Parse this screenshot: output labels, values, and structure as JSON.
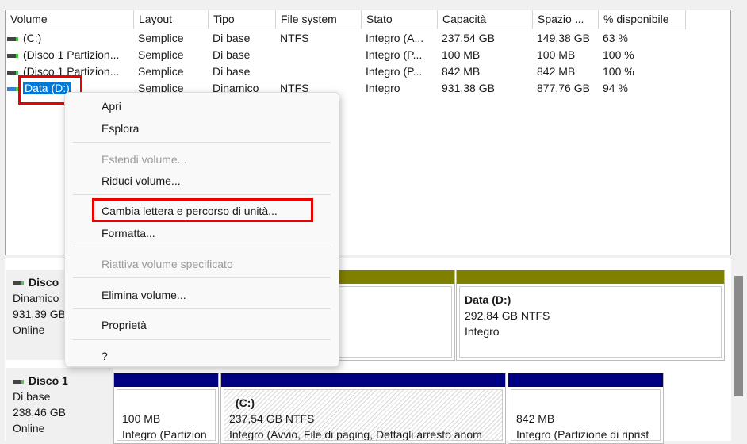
{
  "columns": [
    "Volume",
    "Layout",
    "Tipo",
    "File system",
    "Stato",
    "Capacità",
    "Spazio ...",
    "% disponibile"
  ],
  "rows": [
    [
      "(C:)",
      "Semplice",
      "Di base",
      "NTFS",
      "Integro (A...",
      "237,54 GB",
      "149,38 GB",
      "63 %"
    ],
    [
      "(Disco 1 Partizion...",
      "Semplice",
      "Di base",
      "",
      "Integro (P...",
      "100 MB",
      "100 MB",
      "100 %"
    ],
    [
      "(Disco 1 Partizion...",
      "Semplice",
      "Di base",
      "",
      "Integro (P...",
      "842 MB",
      "842 MB",
      "100 %"
    ],
    [
      "Data (D:)",
      "Semplice",
      "Dinamico",
      "NTFS",
      "Integro",
      "931,38 GB",
      "877,76 GB",
      "94 %"
    ]
  ],
  "menu": {
    "open": "Apri",
    "explore": "Esplora",
    "extend": "Estendi volume...",
    "shrink": "Riduci volume...",
    "change_letter": "Cambia lettera e percorso di unità...",
    "format": "Formatta...",
    "reactivate": "Riattiva volume specificato",
    "delete": "Elimina volume...",
    "properties": "Proprietà",
    "help": "?"
  },
  "disk0": {
    "name": "Disco",
    "type": "Dinamico",
    "size": "931,39 GB",
    "status": "Online",
    "partition": {
      "name": "Data  (D:)",
      "size": "292,84 GB NTFS",
      "status": "Integro"
    }
  },
  "disk1": {
    "name": "Disco 1",
    "type": "Di base",
    "size": "238,46 GB",
    "status": "Online",
    "partitions": [
      {
        "name": "",
        "size": "100 MB",
        "status": "Integro (Partizion"
      },
      {
        "name": "(C:)",
        "size": "237,54 GB NTFS",
        "status": "Integro (Avvio, File di paging, Dettagli arresto anom"
      },
      {
        "name": "",
        "size": "842 MB",
        "status": "Integro (Partizione di riprist"
      }
    ]
  },
  "colors": {
    "dynamic": "#808000",
    "basic": "#000080",
    "highlight": "#e00000"
  }
}
